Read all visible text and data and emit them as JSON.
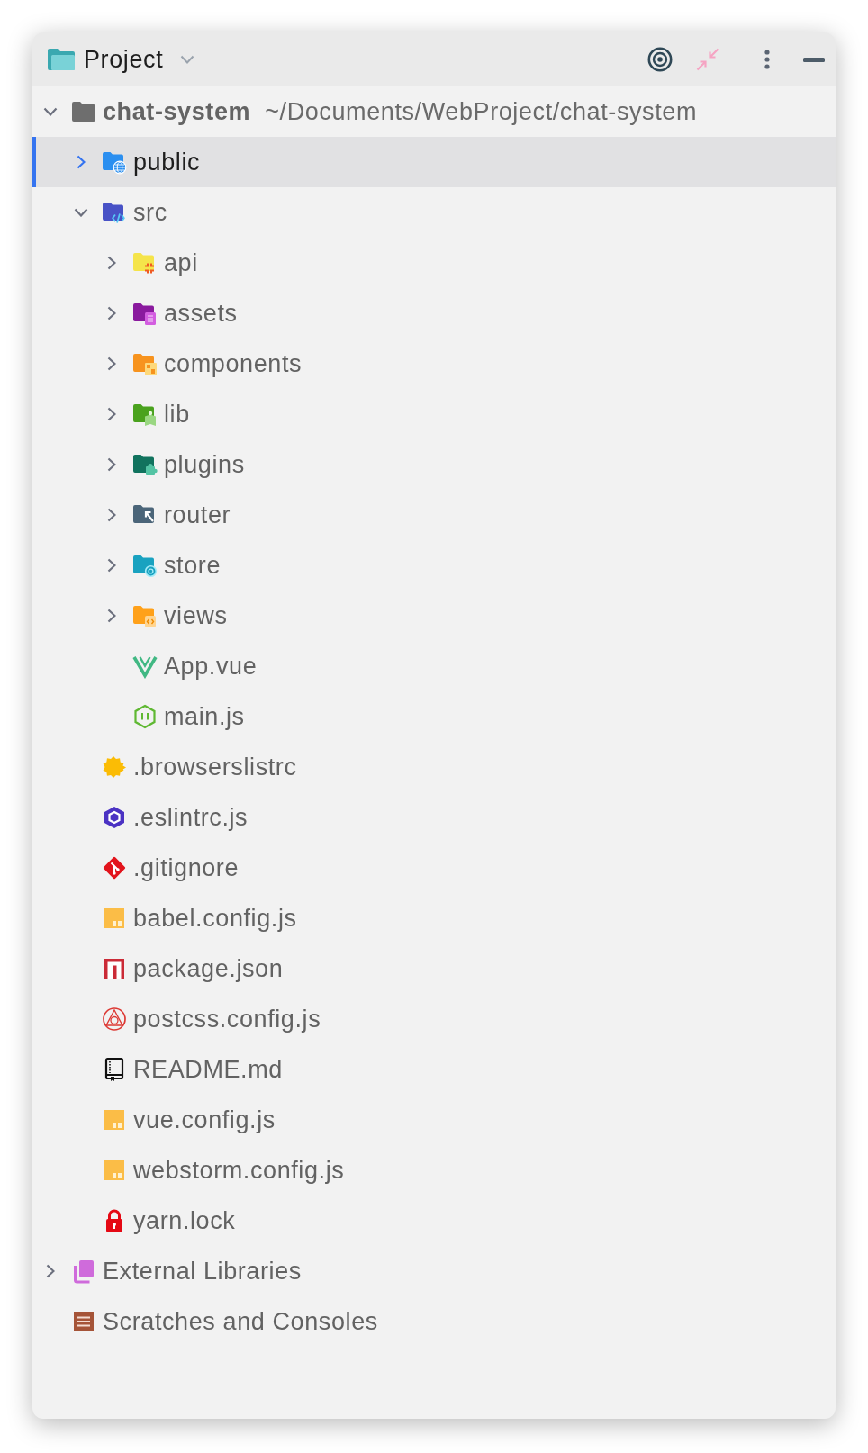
{
  "panel": {
    "title": "Project"
  },
  "tree": [
    {
      "kind": "project",
      "label": "chat-system",
      "path": "~/Documents/WebProject/chat-system",
      "expanded": true,
      "selected": false,
      "children": [
        {
          "kind": "webroot",
          "label": "public",
          "expanded": false,
          "selected": true
        },
        {
          "kind": "source",
          "label": "src",
          "expanded": true,
          "selected": false,
          "children": [
            {
              "kind": "api",
              "label": "api",
              "expanded": false,
              "selected": false
            },
            {
              "kind": "assets",
              "label": "assets",
              "expanded": false,
              "selected": false
            },
            {
              "kind": "components",
              "label": "components",
              "expanded": false,
              "selected": false
            },
            {
              "kind": "lib",
              "label": "lib",
              "expanded": false,
              "selected": false
            },
            {
              "kind": "plugins",
              "label": "plugins",
              "expanded": false,
              "selected": false
            },
            {
              "kind": "router",
              "label": "router",
              "expanded": false,
              "selected": false
            },
            {
              "kind": "store",
              "label": "store",
              "expanded": false,
              "selected": false
            },
            {
              "kind": "views",
              "label": "views",
              "expanded": false,
              "selected": false
            },
            {
              "kind": "vue",
              "label": "App.vue",
              "selected": false
            },
            {
              "kind": "node",
              "label": "main.js",
              "selected": false
            }
          ]
        },
        {
          "kind": "browserslist",
          "label": ".browserslistrc",
          "selected": false
        },
        {
          "kind": "eslint",
          "label": ".eslintrc.js",
          "selected": false
        },
        {
          "kind": "git",
          "label": ".gitignore",
          "selected": false
        },
        {
          "kind": "script",
          "label": "babel.config.js",
          "selected": false
        },
        {
          "kind": "npm",
          "label": "package.json",
          "selected": false
        },
        {
          "kind": "postcss",
          "label": "postcss.config.js",
          "selected": false
        },
        {
          "kind": "readme",
          "label": "README.md",
          "selected": false
        },
        {
          "kind": "script",
          "label": "vue.config.js",
          "selected": false
        },
        {
          "kind": "script",
          "label": "webstorm.config.js",
          "selected": false
        },
        {
          "kind": "lock",
          "label": "yarn.lock",
          "selected": false
        }
      ]
    },
    {
      "kind": "libraries",
      "label": "External Libraries",
      "expanded": false,
      "selected": false
    },
    {
      "kind": "scratches",
      "label": "Scratches and Consoles",
      "selected": false
    }
  ]
}
